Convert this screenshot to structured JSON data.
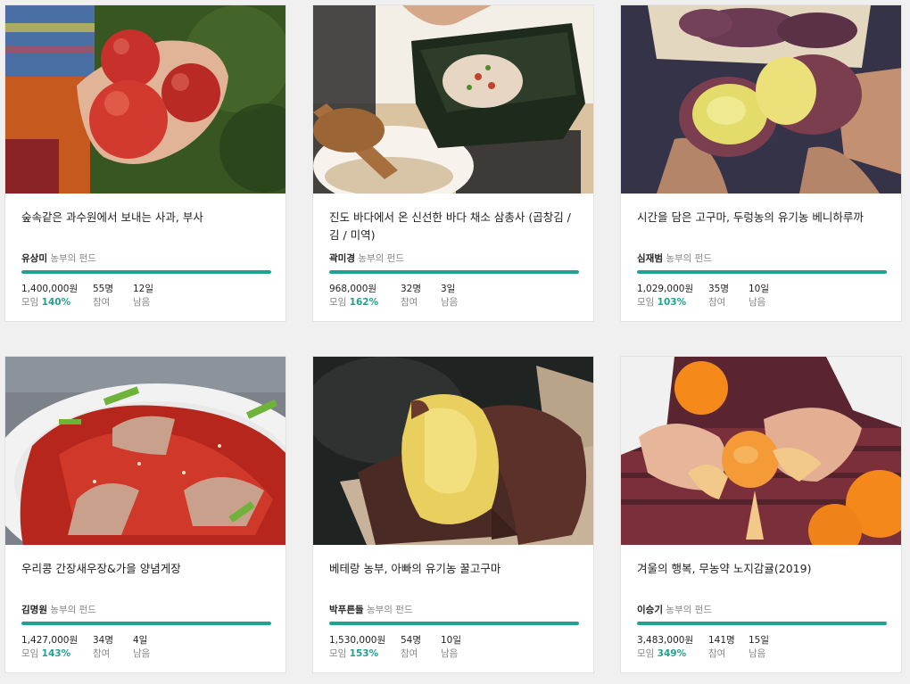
{
  "cards": [
    {
      "title": "숲속같은 과수원에서 보내는 사과, 부사",
      "farmer": "유상미",
      "farmer_suffix": "농부의 펀드",
      "amount": "1,400,000원",
      "raised_label": "모임",
      "percent": "140%",
      "participants": "55명",
      "participants_label": "참여",
      "days": "12일",
      "days_label": "남음",
      "image": "apples-in-hands",
      "progress": 1.0
    },
    {
      "title": "진도 바다에서 온 신선한 바다 채소 삼총사 (곱창김 / 김 / 미역)",
      "farmer": "곽미경",
      "farmer_suffix": "농부의 펀드",
      "amount": "968,000원",
      "raised_label": "모임",
      "percent": "162%",
      "participants": "32명",
      "participants_label": "참여",
      "days": "3일",
      "days_label": "남음",
      "image": "seaweed-rice-wrap",
      "progress": 1.0
    },
    {
      "title": "시간을 담은 고구마, 두렁농의 유기농 베니하루까",
      "farmer": "심재범",
      "farmer_suffix": "농부의 펀드",
      "amount": "1,029,000원",
      "raised_label": "모임",
      "percent": "103%",
      "participants": "35명",
      "participants_label": "참여",
      "days": "10일",
      "days_label": "남음",
      "image": "split-sweet-potato",
      "progress": 1.0
    },
    {
      "title": "우리콩 간장새우장&가을 양념게장",
      "farmer": "김명원",
      "farmer_suffix": "농부의 펀드",
      "amount": "1,427,000원",
      "raised_label": "모임",
      "percent": "143%",
      "participants": "34명",
      "participants_label": "참여",
      "days": "4일",
      "days_label": "남음",
      "image": "spicy-crab",
      "progress": 1.0
    },
    {
      "title": "베테랑 농부, 아빠의 유기농 꿀고구마",
      "farmer": "박푸른들",
      "farmer_suffix": "농부의 펀드",
      "amount": "1,530,000원",
      "raised_label": "모임",
      "percent": "153%",
      "participants": "54명",
      "participants_label": "참여",
      "days": "10일",
      "days_label": "남음",
      "image": "roasted-sweet-potato",
      "progress": 1.0
    },
    {
      "title": "겨울의 행복, 무농약 노지감귤(2019)",
      "farmer": "이승기",
      "farmer_suffix": "농부의 펀드",
      "amount": "3,483,000원",
      "raised_label": "모임",
      "percent": "349%",
      "participants": "141명",
      "participants_label": "참여",
      "days": "15일",
      "days_label": "남음",
      "image": "peeled-tangerine",
      "progress": 1.0
    }
  ],
  "colors": {
    "accent": "#21a18f",
    "background": "#f0f0f0",
    "card": "#ffffff"
  }
}
